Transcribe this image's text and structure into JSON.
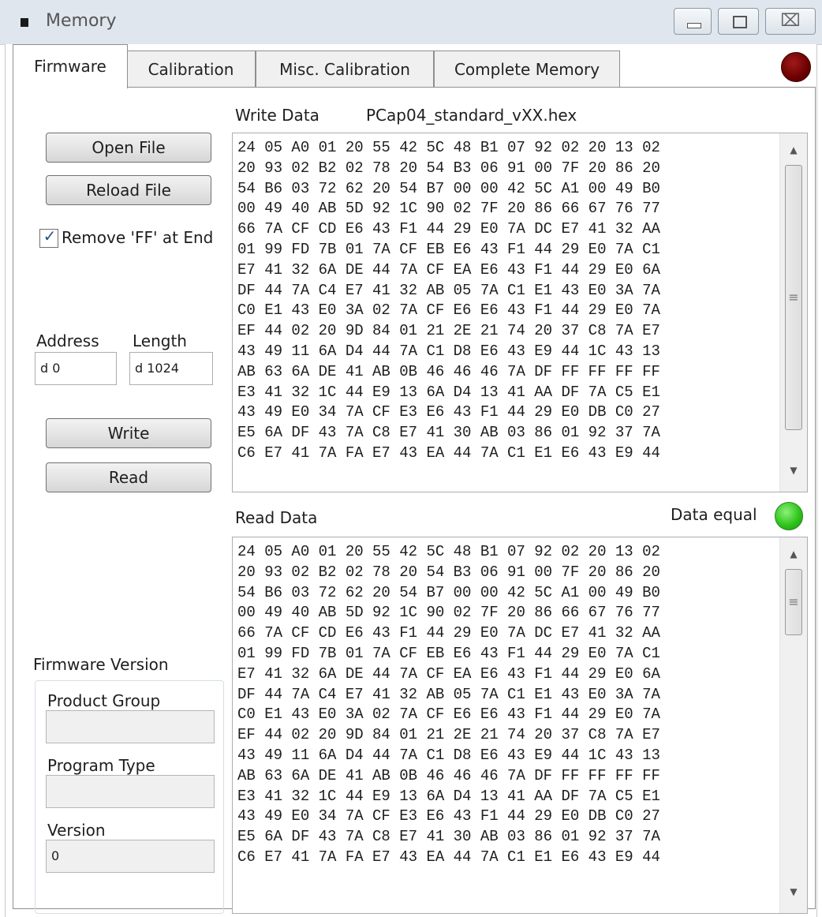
{
  "window": {
    "title": "Memory",
    "minimize_glyph": "",
    "maximize_glyph": "",
    "close_glyph": "⌧"
  },
  "tabs": [
    "Firmware",
    "Calibration",
    "Misc. Calibration",
    "Complete Memory"
  ],
  "status_led": {
    "color": "#8b0000",
    "state": "error"
  },
  "buttons": {
    "open_file": "Open File",
    "reload_file": "Reload File",
    "write": "Write",
    "read": "Read"
  },
  "remove_ff": {
    "label": "Remove 'FF' at End",
    "checked": true
  },
  "address": {
    "label": "Address",
    "value": "d 0"
  },
  "length": {
    "label": "Length",
    "value": "d 1024"
  },
  "firmware_version": {
    "title": "Firmware Version",
    "product_group": {
      "label": "Product Group",
      "value": ""
    },
    "program_type": {
      "label": "Program Type",
      "value": ""
    },
    "version": {
      "label": "Version",
      "value": "0"
    }
  },
  "write_data": {
    "label": "Write Data",
    "filename": "PCap04_standard_vXX.hex",
    "lines": [
      "24 05 A0 01 20 55 42 5C 48 B1 07 92 02 20 13 02",
      "20 93 02 B2 02 78 20 54 B3 06 91 00 7F 20 86 20",
      "54 B6 03 72 62 20 54 B7 00 00 42 5C A1 00 49 B0",
      "00 49 40 AB 5D 92 1C 90 02 7F 20 86 66 67 76 77",
      "66 7A CF CD E6 43 F1 44 29 E0 7A DC E7 41 32 AA",
      "01 99 FD 7B 01 7A CF EB E6 43 F1 44 29 E0 7A C1",
      "E7 41 32 6A DE 44 7A CF EA E6 43 F1 44 29 E0 6A",
      "DF 44 7A C4 E7 41 32 AB 05 7A C1 E1 43 E0 3A 7A",
      "C0 E1 43 E0 3A 02 7A CF E6 E6 43 F1 44 29 E0 7A",
      "EF 44 02 20 9D 84 01 21 2E 21 74 20 37 C8 7A E7",
      "43 49 11 6A D4 44 7A C1 D8 E6 43 E9 44 1C 43 13",
      "AB 63 6A DE 41 AB 0B 46 46 46 7A DF FF FF FF FF",
      "E3 41 32 1C 44 E9 13 6A D4 13 41 AA DF 7A C5 E1",
      "43 49 E0 34 7A CF E3 E6 43 F1 44 29 E0 DB C0 27",
      "E5 6A DF 43 7A C8 E7 41 30 AB 03 86 01 92 37 7A",
      "C6 E7 41 7A FA E7 43 EA 44 7A C1 E1 E6 43 E9 44"
    ]
  },
  "read_data": {
    "label": "Read Data",
    "status_label": "Data equal",
    "status_color": "#2fc51c",
    "lines": [
      "24 05 A0 01 20 55 42 5C 48 B1 07 92 02 20 13 02",
      "20 93 02 B2 02 78 20 54 B3 06 91 00 7F 20 86 20",
      "54 B6 03 72 62 20 54 B7 00 00 42 5C A1 00 49 B0",
      "00 49 40 AB 5D 92 1C 90 02 7F 20 86 66 67 76 77",
      "66 7A CF CD E6 43 F1 44 29 E0 7A DC E7 41 32 AA",
      "01 99 FD 7B 01 7A CF EB E6 43 F1 44 29 E0 7A C1",
      "E7 41 32 6A DE 44 7A CF EA E6 43 F1 44 29 E0 6A",
      "DF 44 7A C4 E7 41 32 AB 05 7A C1 E1 43 E0 3A 7A",
      "C0 E1 43 E0 3A 02 7A CF E6 E6 43 F1 44 29 E0 7A",
      "EF 44 02 20 9D 84 01 21 2E 21 74 20 37 C8 7A E7",
      "43 49 11 6A D4 44 7A C1 D8 E6 43 E9 44 1C 43 13",
      "AB 63 6A DE 41 AB 0B 46 46 46 7A DF FF FF FF FF",
      "E3 41 32 1C 44 E9 13 6A D4 13 41 AA DF 7A C5 E1",
      "43 49 E0 34 7A CF E3 E6 43 F1 44 29 E0 DB C0 27",
      "E5 6A DF 43 7A C8 E7 41 30 AB 03 86 01 92 37 7A",
      "C6 E7 41 7A FA E7 43 EA 44 7A C1 E1 E6 43 E9 44"
    ]
  }
}
